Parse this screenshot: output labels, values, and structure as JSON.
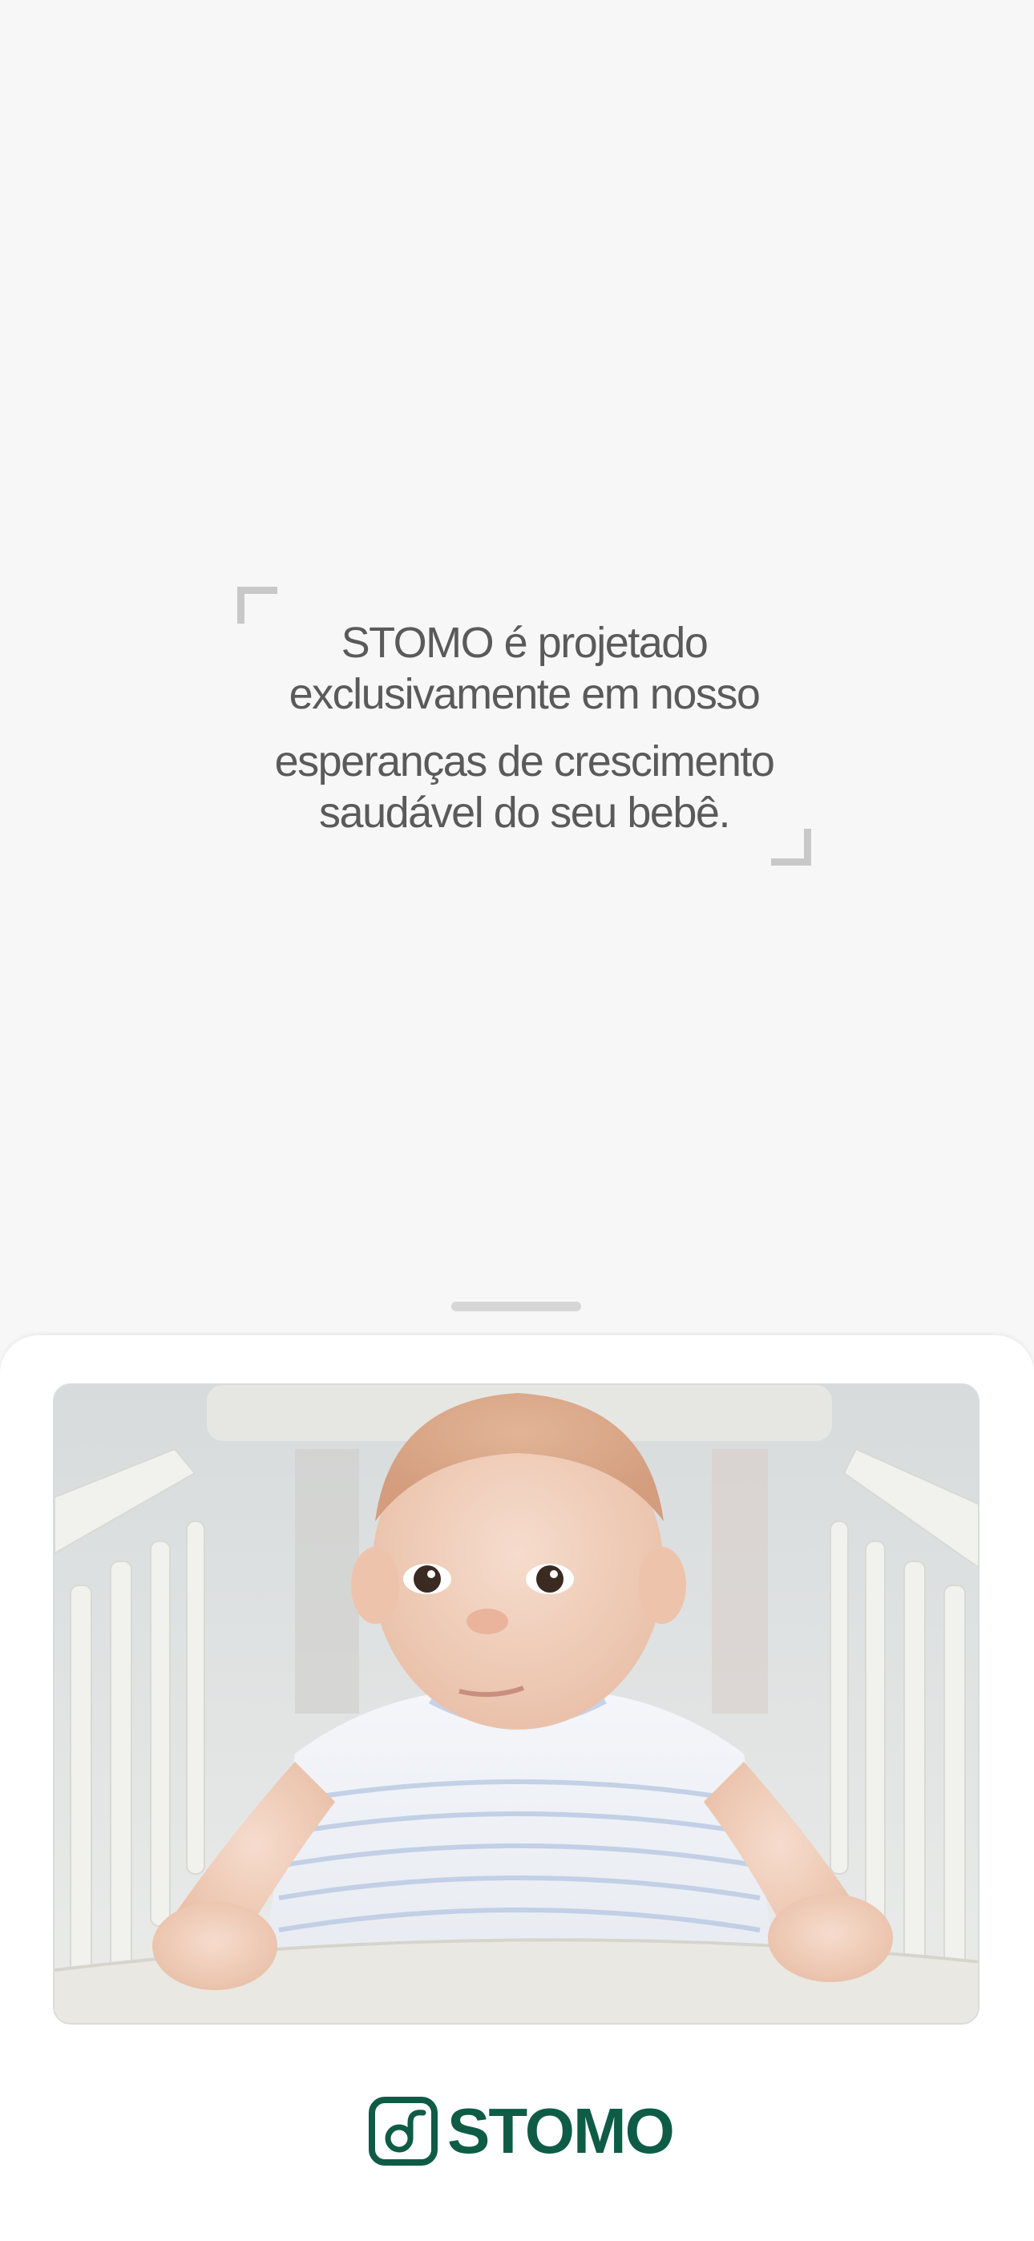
{
  "quote": {
    "lines": [
      "STOMO é projetado",
      "exclusivamente em nosso",
      "esperanças de crescimento",
      "saudável do seu bebê."
    ]
  },
  "photo": {
    "subject": "baby-in-crib"
  },
  "brand": {
    "logo_icon": "stomo-logo-icon",
    "name": "STOMO",
    "color": "#0e5c45"
  },
  "colors": {
    "background": "#f7f7f7",
    "quote_text": "#5a5a5a",
    "bracket": "#c8c8c8",
    "sheet": "#ffffff"
  }
}
